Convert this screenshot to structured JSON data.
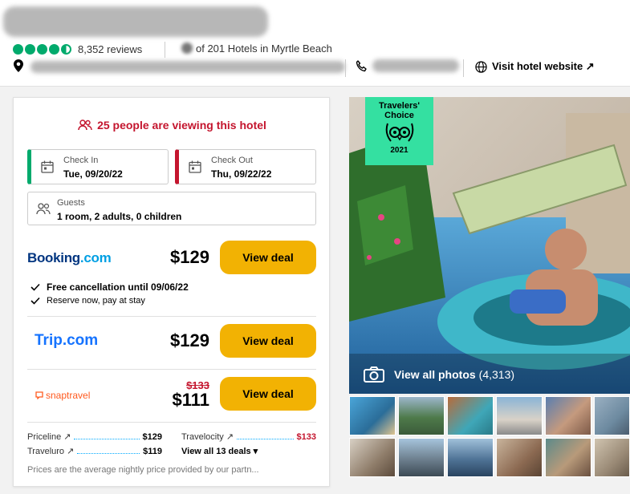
{
  "header": {
    "review_count": "8,352 reviews",
    "rank_text": "of 201 Hotels in Myrtle Beach",
    "visit_website": "Visit hotel website ↗",
    "bubble_rating": 4.5
  },
  "booking": {
    "viewing_text": "25 people are viewing this hotel",
    "check_in_label": "Check In",
    "check_in_value": "Tue, 09/20/22",
    "check_out_label": "Check Out",
    "check_out_value": "Thu, 09/22/22",
    "guests_label": "Guests",
    "guests_value": "1 room, 2 adults, 0 children"
  },
  "offers": [
    {
      "provider": "Booking.com",
      "price": "$129",
      "button": "View deal",
      "perks": [
        "Free cancellation until 09/06/22",
        "Reserve now, pay at stay"
      ]
    },
    {
      "provider": "Trip.com",
      "price": "$129",
      "button": "View deal"
    },
    {
      "provider": "snaptravel",
      "old_price": "$133",
      "price": "$111",
      "button": "View deal"
    }
  ],
  "more_deals": {
    "items": [
      {
        "name": "Priceline ↗",
        "price": "$129"
      },
      {
        "name": "Travelocity ↗",
        "price": "$133"
      },
      {
        "name": "Traveluro ↗",
        "price": "$119"
      }
    ],
    "view_all": "View all 13 deals ▾"
  },
  "disclaimer": "Prices are the average nightly price provided by our partn...",
  "photos": {
    "badge_line1": "Travelers'",
    "badge_line2": "Choice",
    "badge_year": "2021",
    "view_all_label": "View all photos",
    "count": "(4,313)"
  },
  "colors": {
    "accent_red": "#c4152e",
    "accent_green": "#00aa6c",
    "button_yellow": "#f2b203"
  }
}
